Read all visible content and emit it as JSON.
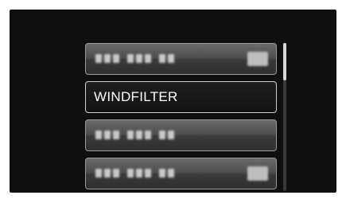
{
  "menu": {
    "items": [
      {
        "label": "",
        "redacted": true,
        "has_icon": true
      },
      {
        "label": "WINDFILTER",
        "redacted": false,
        "has_icon": false,
        "selected": true
      },
      {
        "label": "",
        "redacted": true,
        "has_icon": false
      },
      {
        "label": "",
        "redacted": true,
        "has_icon": true
      }
    ]
  },
  "scrollbar": {
    "position_fraction": 0.0,
    "visible_fraction": 0.25
  }
}
